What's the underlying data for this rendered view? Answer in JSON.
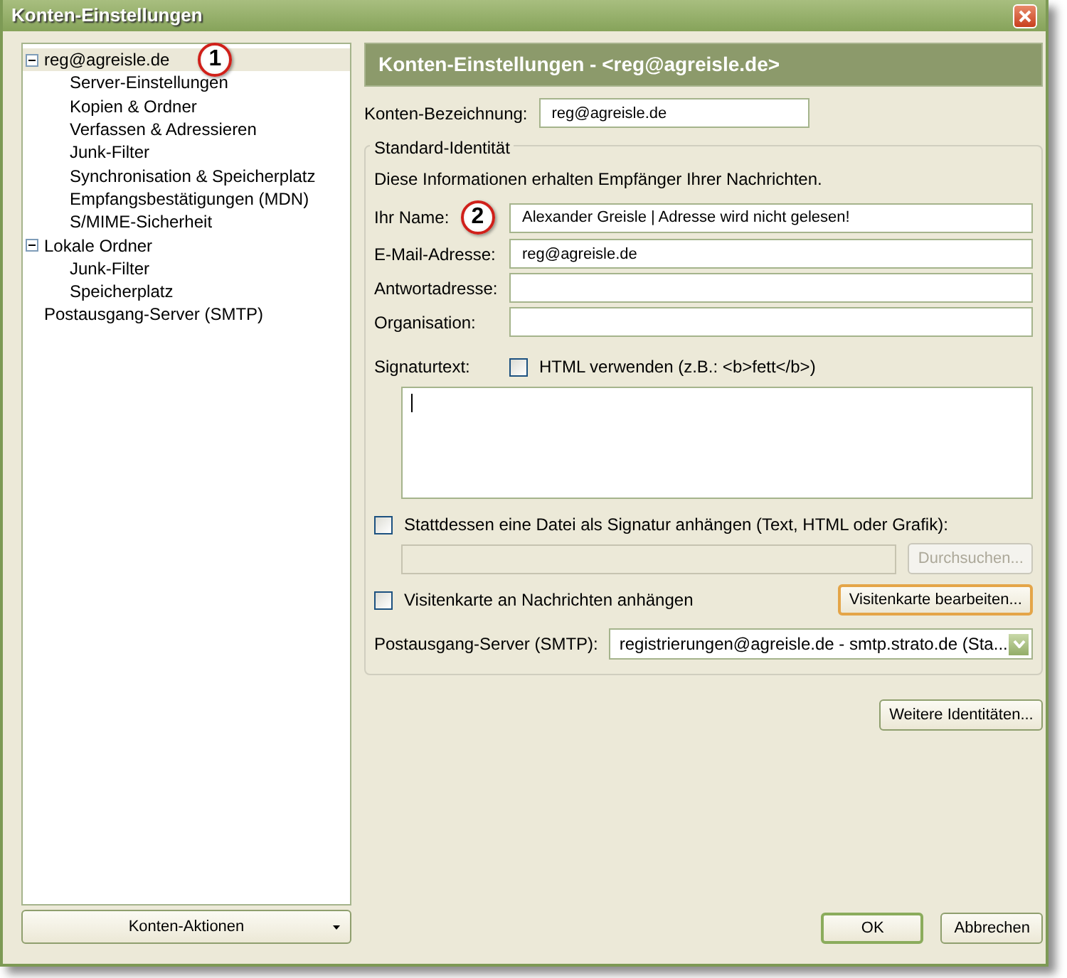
{
  "window": {
    "title": "Konten-Einstellungen"
  },
  "sidebar": {
    "tree": [
      {
        "label": "reg@agreisle.de",
        "expanded": true,
        "selected": true,
        "callout": "1",
        "children": [
          {
            "label": "Server-Einstellungen",
            "selected": false
          },
          {
            "label": "Kopien & Ordner",
            "selected": false
          },
          {
            "label": "Verfassen & Adressieren",
            "selected": false
          },
          {
            "label": "Junk-Filter",
            "selected": false
          },
          {
            "label": "Synchronisation & Speicherplatz",
            "selected": false
          },
          {
            "label": "Empfangsbestätigungen (MDN)",
            "selected": false
          },
          {
            "label": "S/MIME-Sicherheit",
            "selected": false
          }
        ]
      },
      {
        "label": "Lokale Ordner",
        "expanded": true,
        "selected": false,
        "children": [
          {
            "label": "Junk-Filter",
            "selected": false
          },
          {
            "label": "Speicherplatz",
            "selected": false
          }
        ]
      },
      {
        "label": "Postausgang-Server (SMTP)",
        "selected": false
      }
    ],
    "actions_button": "Konten-Aktionen"
  },
  "panel": {
    "header": "Konten-Einstellungen - <reg@agreisle.de>",
    "account_name": {
      "label": "Konten-Bezeichnung:",
      "value": "reg@agreisle.de"
    },
    "identity": {
      "legend": "Standard-Identität",
      "description": "Diese Informationen erhalten Empfänger Ihrer Nachrichten.",
      "fields": [
        {
          "label": "Ihr Name:",
          "value": "Alexander Greisle | Adresse wird nicht gelesen!",
          "callout": "2"
        },
        {
          "label": "E-Mail-Adresse:",
          "value": "reg@agreisle.de"
        },
        {
          "label": "Antwortadresse:"
        },
        {
          "label": "Organisation:"
        }
      ],
      "signature": {
        "label": "Signaturtext:",
        "html_checkbox": {
          "label": "HTML verwenden (z.B.: <b>fett</b>)",
          "checked": false
        }
      },
      "file_option": {
        "label": "Stattdessen eine Datei als Signatur anhängen (Text, HTML oder Grafik):",
        "checked": false
      },
      "file_field": {
        "disabled": true
      },
      "browse_button": {
        "label": "Durchsuchen...",
        "disabled": true
      },
      "vcard_option": {
        "label": "Visitenkarte an Nachrichten anhängen",
        "checked": false
      },
      "vcard_button": {
        "label": "Visitenkarte bearbeiten...",
        "focused": true
      },
      "smtp": {
        "label": "Postausgang-Server (SMTP):",
        "value": "registrierungen@agreisle.de - smtp.strato.de (Sta..."
      }
    },
    "more_button": "Weitere Identitäten..."
  },
  "buttons": [
    {
      "label": "OK",
      "default": true
    },
    {
      "label": "Abbrechen",
      "default": false
    }
  ]
}
